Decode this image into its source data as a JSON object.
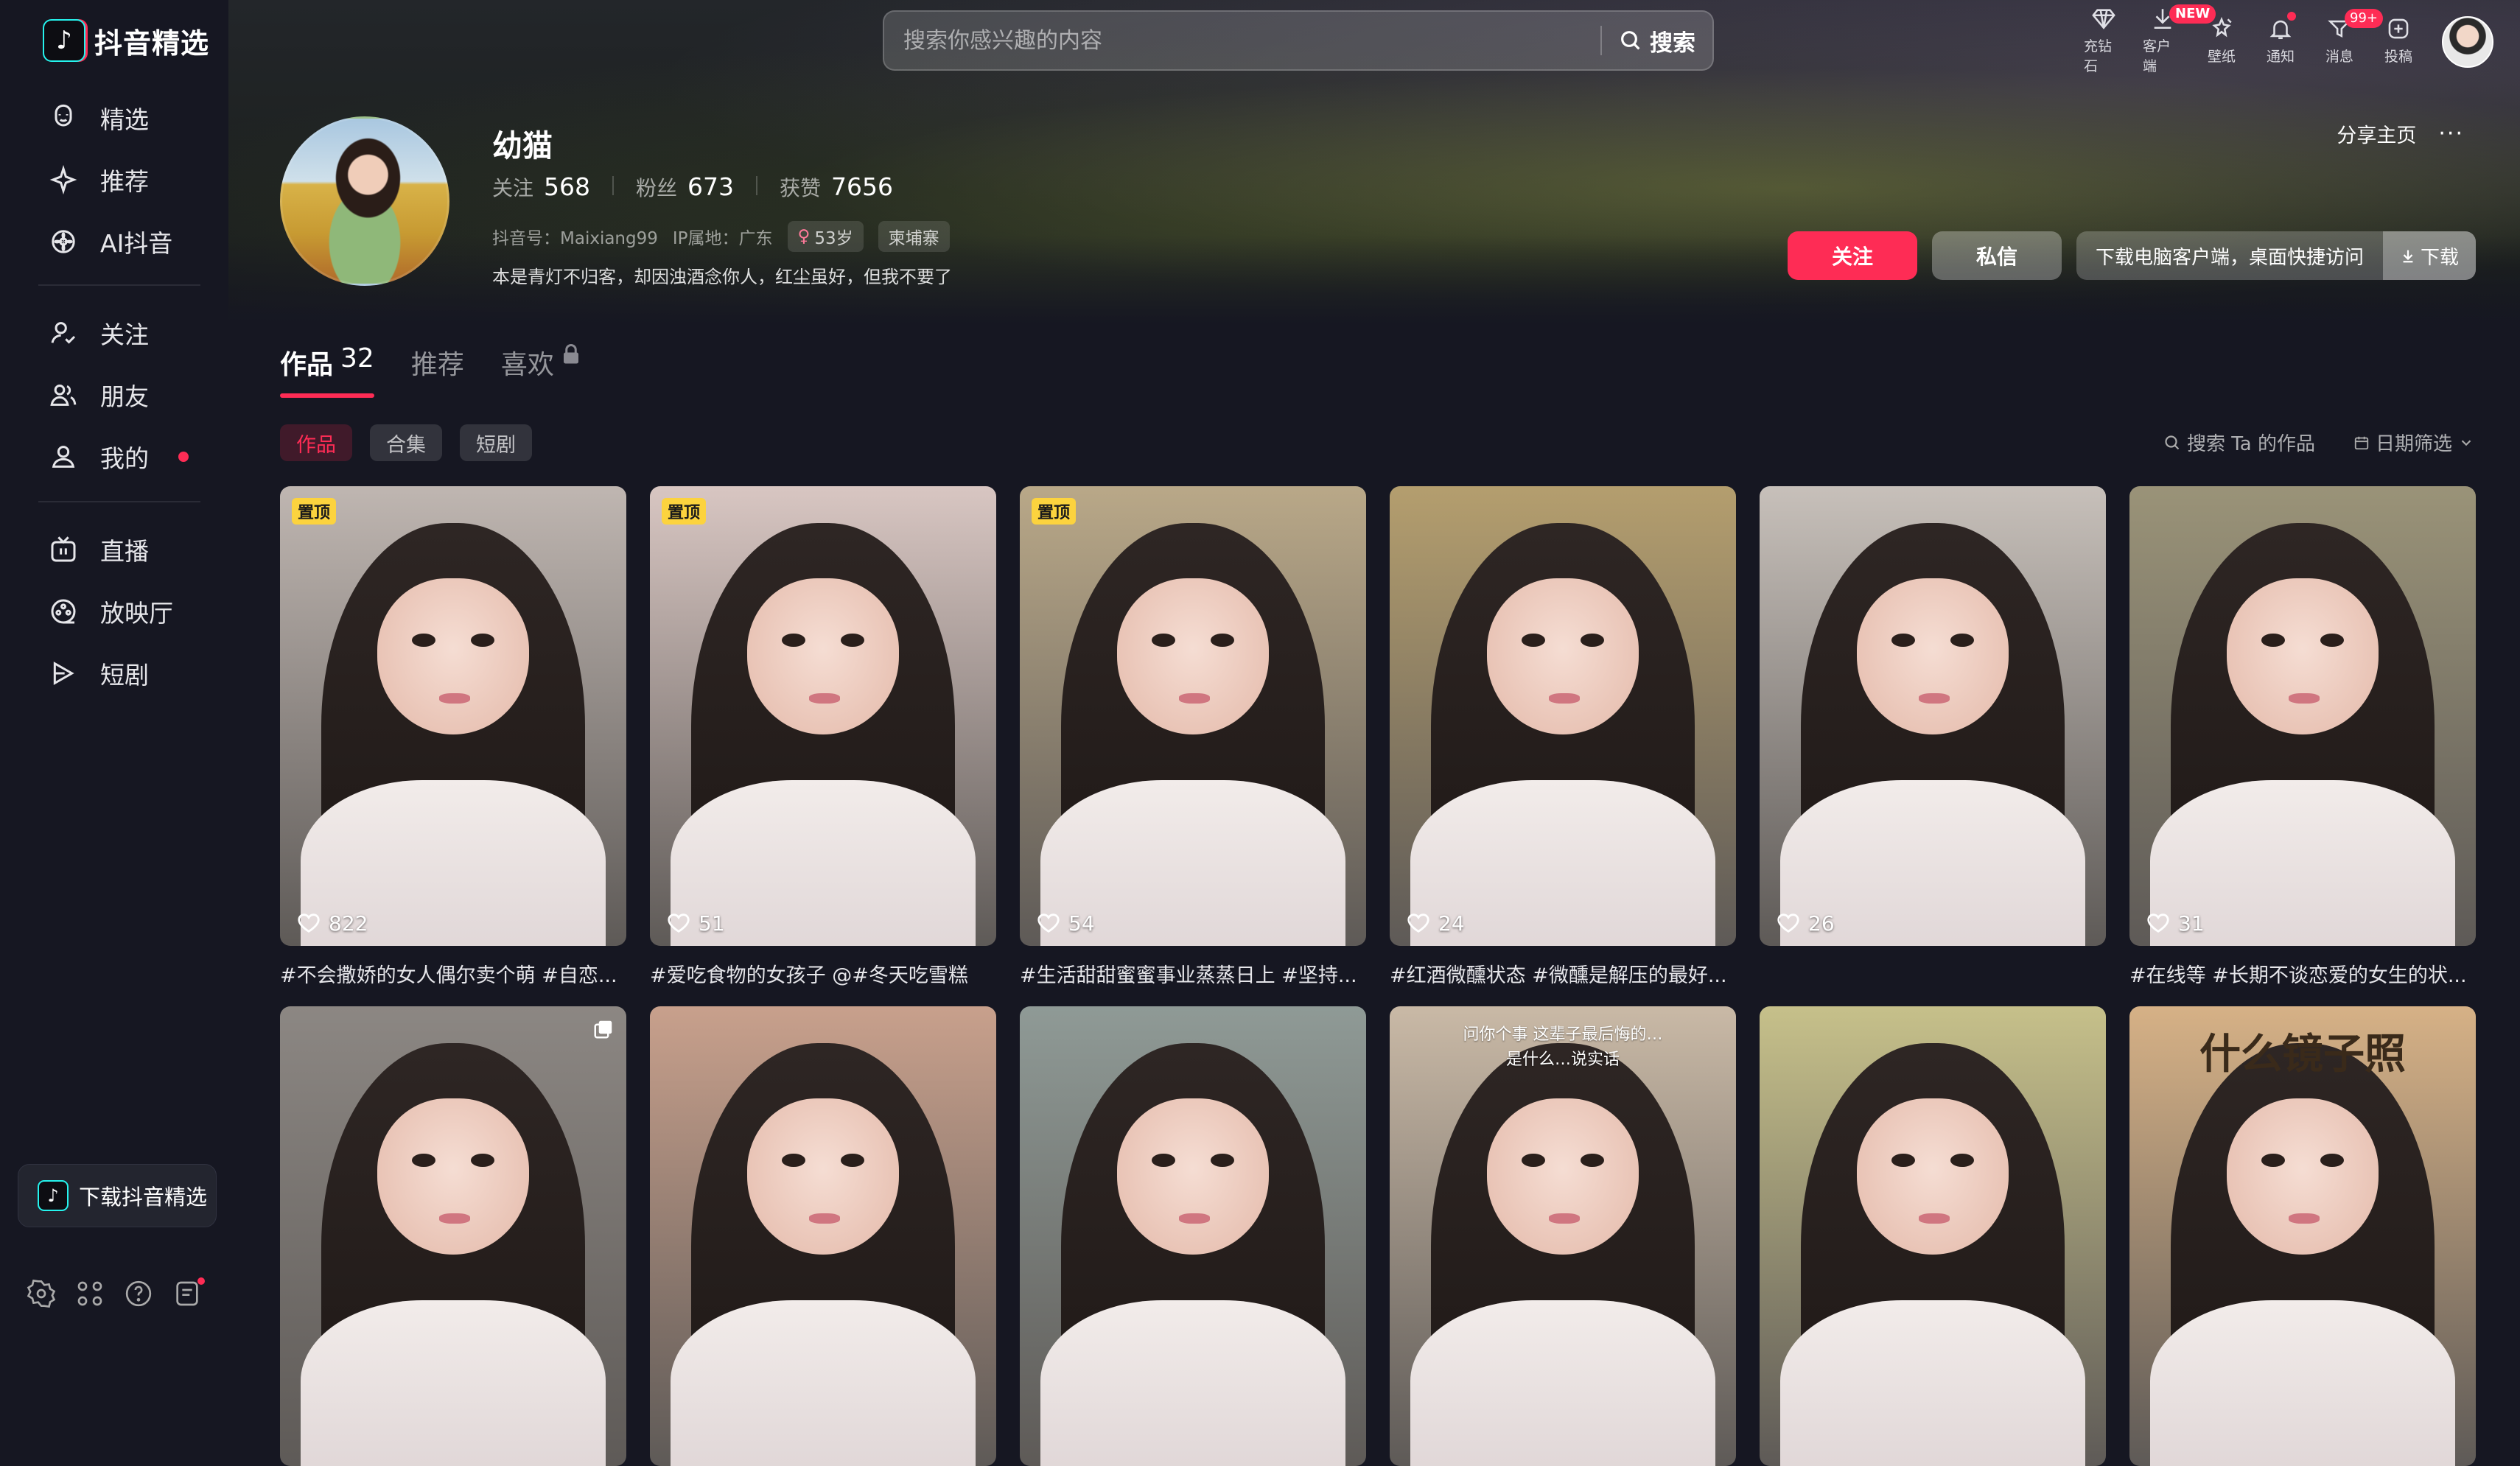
{
  "app": {
    "name": "抖音精选"
  },
  "sidebar": {
    "groups": [
      [
        {
          "label": "精选",
          "icon": "smile-icon"
        },
        {
          "label": "推荐",
          "icon": "sparkle-icon"
        },
        {
          "label": "AI抖音",
          "icon": "flower-icon"
        }
      ],
      [
        {
          "label": "关注",
          "icon": "follow-icon"
        },
        {
          "label": "朋友",
          "icon": "friends-icon"
        },
        {
          "label": "我的",
          "icon": "person-icon",
          "dot": true
        }
      ],
      [
        {
          "label": "直播",
          "icon": "tv-icon"
        },
        {
          "label": "放映厅",
          "icon": "theater-icon"
        },
        {
          "label": "短剧",
          "icon": "play-icon"
        }
      ]
    ],
    "download_label": "下载抖音精选",
    "bottom_icons": [
      "settings-icon",
      "apps-icon",
      "help-icon",
      "feedback-icon"
    ]
  },
  "search": {
    "placeholder": "搜索你感兴趣的内容",
    "button": "搜索"
  },
  "top_actions": [
    {
      "label": "充钻石",
      "icon": "diamond-icon"
    },
    {
      "label": "客户端",
      "icon": "download-icon",
      "badge": "NEW"
    },
    {
      "label": "壁纸",
      "icon": "wallpaper-icon"
    },
    {
      "label": "通知",
      "icon": "bell-icon",
      "dot": true
    },
    {
      "label": "消息",
      "icon": "message-icon",
      "badge": "99+"
    },
    {
      "label": "投稿",
      "icon": "upload-icon"
    }
  ],
  "profile": {
    "name": "幼猫",
    "stats": [
      {
        "label": "关注",
        "value": "568"
      },
      {
        "label": "粉丝",
        "value": "673"
      },
      {
        "label": "获赞",
        "value": "7656"
      }
    ],
    "douyin_id": "抖音号：Maixiang99",
    "ip": "IP属地：广东",
    "age": "53岁",
    "location_tag": "柬埔寨",
    "bio": "本是青灯不归客，却因浊酒念你人，红尘虽好，但我不要了",
    "share": "分享主页",
    "more": "···"
  },
  "actions": {
    "follow": "关注",
    "message": "私信",
    "download_text": "下载电脑客户端，桌面快捷访问",
    "download_btn": "下载"
  },
  "tabs": [
    {
      "label": "作品",
      "count": "32",
      "active": true
    },
    {
      "label": "推荐",
      "count": ""
    },
    {
      "label": "喜欢",
      "count": "",
      "lock": true
    }
  ],
  "filters": [
    {
      "label": "作品",
      "active": true
    },
    {
      "label": "合集"
    },
    {
      "label": "短剧"
    }
  ],
  "tools": {
    "search": "搜索 Ta 的作品",
    "date": "日期筛选"
  },
  "videos": [
    {
      "pinned": "置顶",
      "likes": "822",
      "caption": "#不会撒娇的女人偶尔卖个萌 #自恋...",
      "bg": "#bfb6b1"
    },
    {
      "pinned": "置顶",
      "likes": "51",
      "caption": "#爱吃食物的女孩子 @#冬天吃雪糕",
      "bg": "#d8c6c2"
    },
    {
      "pinned": "置顶",
      "likes": "54",
      "caption": "#生活甜甜蜜蜜事业蒸蒸日上 #坚持...",
      "bg": "#b9a888"
    },
    {
      "pinned": "",
      "likes": "24",
      "caption": "#红酒微醺状态 #微醺是解压的最好...",
      "bg": "#b49e6e"
    },
    {
      "pinned": "",
      "likes": "26",
      "caption": "",
      "bg": "#c7c0ba"
    },
    {
      "pinned": "",
      "likes": "31",
      "caption": "#在线等 #长期不谈恋爱的女生的状...",
      "bg": "#9a9378"
    },
    {
      "pinned": "",
      "likes": "",
      "caption": "",
      "bg": "#8c8783",
      "multi": true
    },
    {
      "pinned": "",
      "likes": "",
      "caption": "",
      "bg": "#c8a08c"
    },
    {
      "pinned": "",
      "likes": "",
      "caption": "",
      "bg": "#8f9a96"
    },
    {
      "pinned": "",
      "likes": "",
      "caption": "",
      "bg": "#c9b9a6",
      "overlay": [
        "问你个事 这辈子最后悔的…",
        "是什么…说实话"
      ]
    },
    {
      "pinned": "",
      "likes": "",
      "caption": "",
      "bg": "#c6c08a"
    },
    {
      "pinned": "",
      "likes": "",
      "caption": "",
      "bg": "#d6b186",
      "overlay": [
        "什么镜子照"
      ]
    }
  ],
  "colors": {
    "accent": "#fe2c55",
    "background": "#161722"
  }
}
